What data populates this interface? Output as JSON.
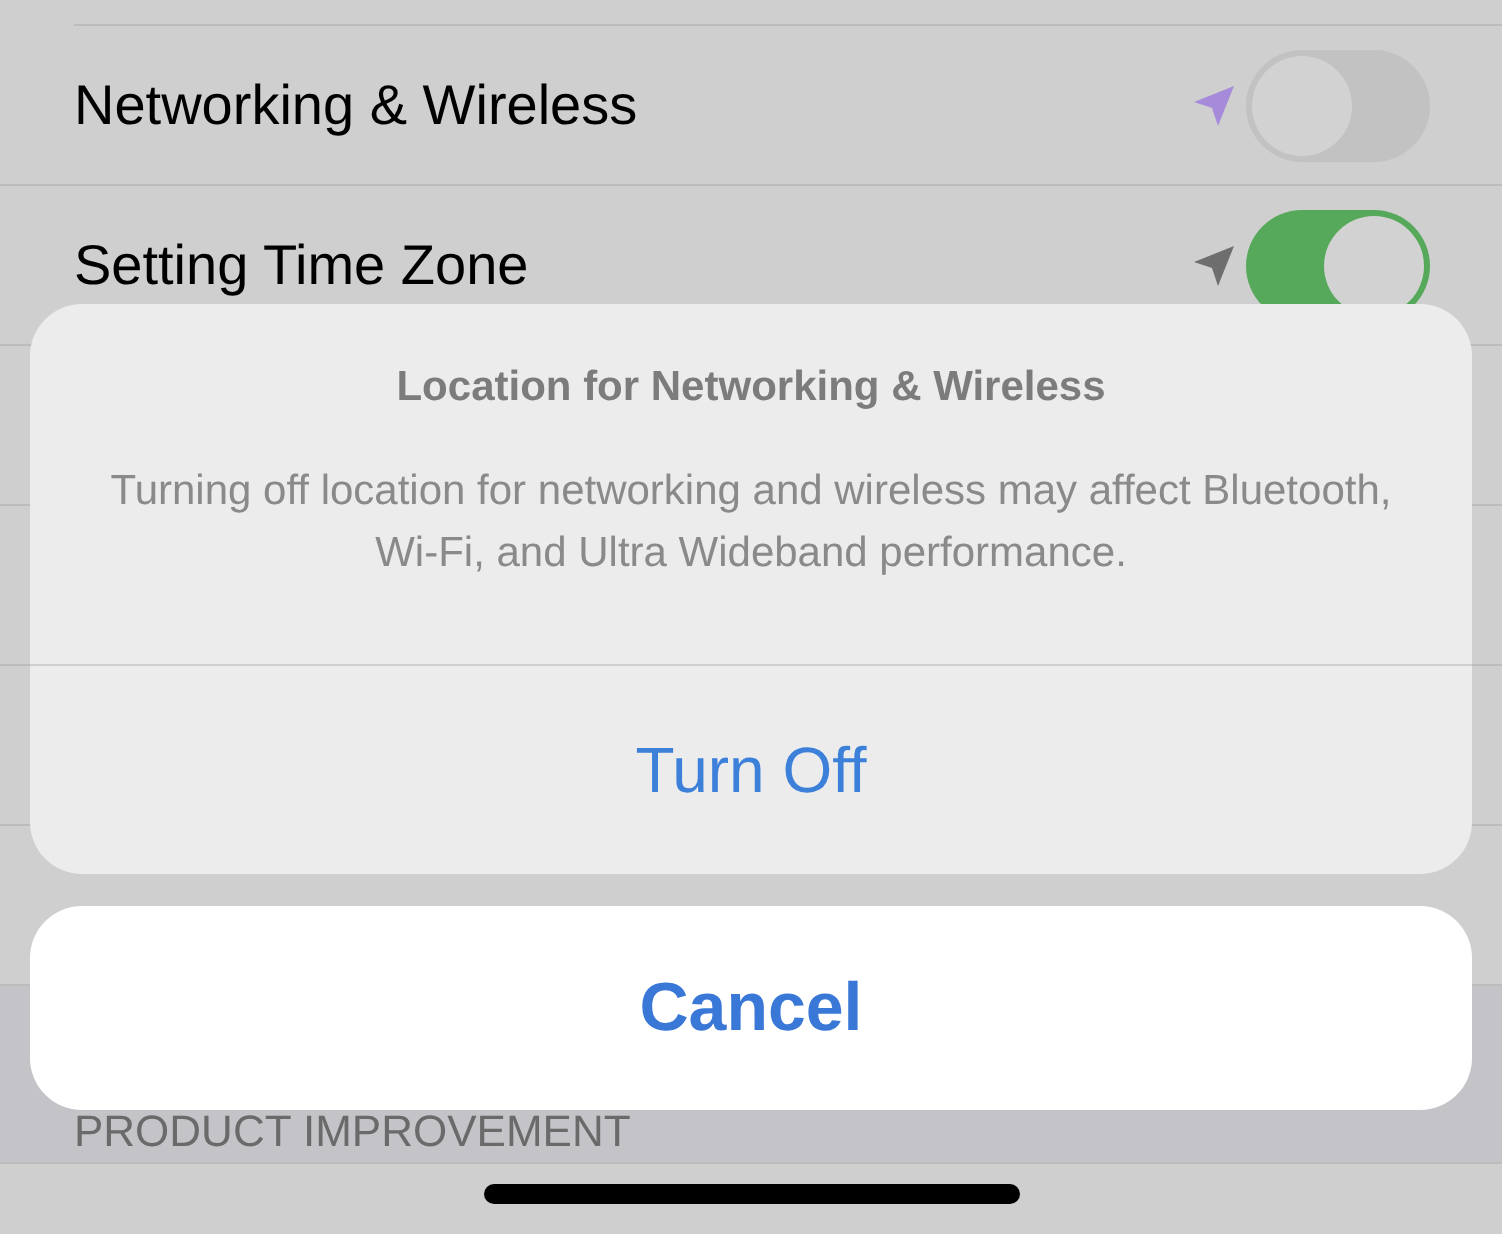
{
  "settings_rows": [
    {
      "label": "Networking & Wireless",
      "kind": "toggle",
      "on": false,
      "color": "#a78bdb"
    },
    {
      "label": "Setting Time Zone",
      "kind": "toggle",
      "on": true,
      "color": "#6e6e6e"
    }
  ],
  "alert": {
    "title": "Location for Networking & Wireless",
    "message": "Turning off location for networking and wireless may affect Bluetooth, Wi-Fi, and Ultra Wideband performance.",
    "actions": [
      "Turn Off"
    ]
  },
  "cancel_button": "Cancel",
  "section_header": "PRODUCT IMPROVEMENT"
}
